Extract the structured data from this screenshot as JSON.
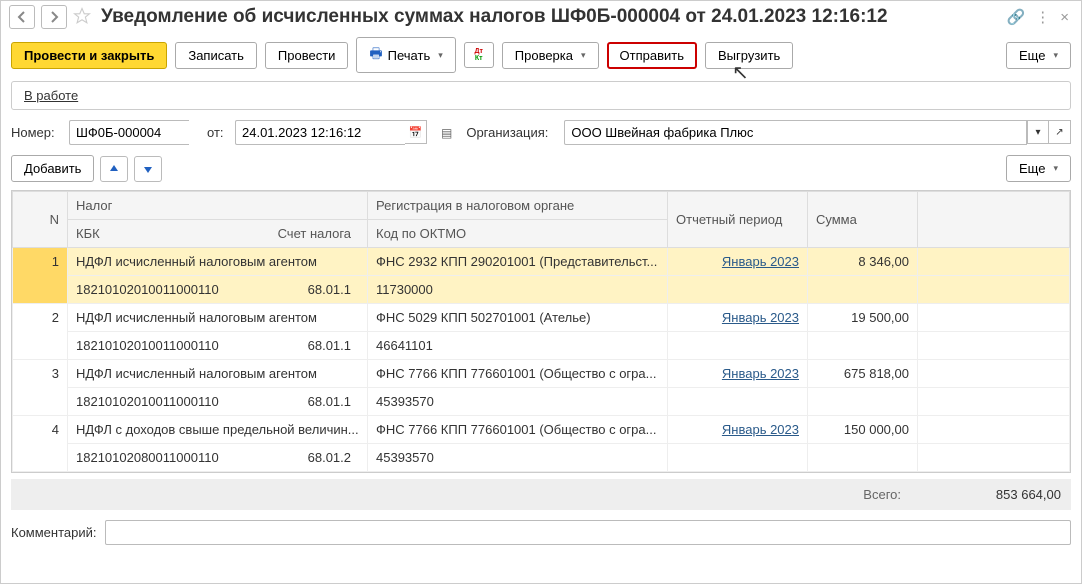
{
  "window": {
    "title": "Уведомление об исчисленных суммах налогов ШФ0Б-000004 от 24.01.2023 12:16:12"
  },
  "toolbar": {
    "post_and_close": "Провести и закрыть",
    "write": "Записать",
    "post": "Провести",
    "print": "Печать",
    "check": "Проверка",
    "send": "Отправить",
    "export": "Выгрузить",
    "more": "Еще"
  },
  "status": {
    "in_work": "В работе"
  },
  "form": {
    "number_label": "Номер:",
    "number_value": "ШФ0Б-000004",
    "date_label": "от:",
    "date_value": "24.01.2023 12:16:12",
    "org_label": "Организация:",
    "org_value": "ООО Швейная фабрика Плюс"
  },
  "table_toolbar": {
    "add": "Добавить",
    "more": "Еще"
  },
  "headers": {
    "n": "N",
    "tax": "Налог",
    "kbk": "КБК",
    "account": "Счет налога",
    "registration": "Регистрация в налоговом органе",
    "oktmo": "Код по ОКТМО",
    "period": "Отчетный период",
    "sum": "Сумма"
  },
  "rows": [
    {
      "n": "1",
      "tax": "НДФЛ исчисленный налоговым агентом",
      "kbk": "18210102010011000110",
      "account": "68.01.1",
      "registration": "ФНС 2932 КПП 290201001 (Представительст...",
      "oktmo": "11730000",
      "period": "Январь 2023",
      "sum": "8 346,00"
    },
    {
      "n": "2",
      "tax": "НДФЛ исчисленный налоговым агентом",
      "kbk": "18210102010011000110",
      "account": "68.01.1",
      "registration": "ФНС 5029 КПП 502701001 (Ателье)",
      "oktmo": "46641101",
      "period": "Январь 2023",
      "sum": "19 500,00"
    },
    {
      "n": "3",
      "tax": "НДФЛ исчисленный налоговым агентом",
      "kbk": "18210102010011000110",
      "account": "68.01.1",
      "registration": "ФНС 7766 КПП 776601001 (Общество с огра...",
      "oktmo": "45393570",
      "period": "Январь 2023",
      "sum": "675 818,00"
    },
    {
      "n": "4",
      "tax": "НДФЛ с доходов свыше предельной величин...",
      "kbk": "18210102080011000110",
      "account": "68.01.2",
      "registration": "ФНС 7766 КПП 776601001 (Общество с огра...",
      "oktmo": "45393570",
      "period": "Январь 2023",
      "sum": "150 000,00"
    }
  ],
  "totals": {
    "label": "Всего:",
    "value": "853 664,00"
  },
  "comment": {
    "label": "Комментарий:",
    "value": ""
  }
}
